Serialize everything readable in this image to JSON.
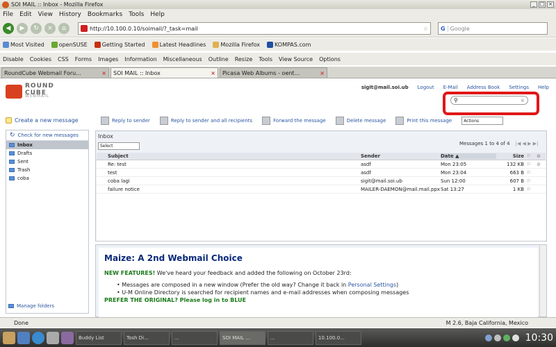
{
  "window": {
    "title": "SOI MAIL :: Inbox - Mozilla Firefox"
  },
  "menu": [
    "File",
    "Edit",
    "View",
    "History",
    "Bookmarks",
    "Tools",
    "Help"
  ],
  "nav": {
    "url": "http://10.100.0.10/soimail/?_task=mail",
    "search_placeholder": "Google"
  },
  "bookmarks": [
    "Most Visited",
    "openSUSE",
    "Getting Started",
    "Latest Headlines",
    "Mozilla Firefox",
    "KOMPAS.com"
  ],
  "devtools": [
    "Disable",
    "Cookies",
    "CSS",
    "Forms",
    "Images",
    "Information",
    "Miscellaneous",
    "Outline",
    "Resize",
    "Tools",
    "View Source",
    "Options"
  ],
  "tabs": [
    "RoundCube Webmail Foru...",
    "SOI MAIL :: Inbox",
    "Picasa Web Albums - oent..."
  ],
  "header": {
    "logo_top": "ROUND CUBE",
    "logo_bottom": "WEBMAIL",
    "user": "sigit@mail.soi.ub",
    "links": [
      "Logout",
      "E-Mail",
      "Address Book",
      "Settings",
      "Help"
    ]
  },
  "sidebar": {
    "create": "Create a new message",
    "check": "Check for new messages",
    "folders": [
      "Inbox",
      "Drafts",
      "Sent",
      "Trash",
      "coba"
    ],
    "manage": "Manage folders"
  },
  "toolbar": {
    "reply": "Reply to sender",
    "reply_all": "Reply to sender and all recipients",
    "forward": "Forward the message",
    "delete": "Delete message",
    "print": "Print this message",
    "actions": "Actions"
  },
  "inbox": {
    "label": "Inbox",
    "select": "Select",
    "count": "Messages 1 to 4 of 4",
    "columns": {
      "subject": "Subject",
      "sender": "Sender",
      "date": "Date",
      "size": "Size"
    },
    "messages": [
      {
        "subject": "Re: test",
        "sender": "asdf",
        "date": "Mon 23:05",
        "size": "132 KB"
      },
      {
        "subject": "test",
        "sender": "asdf",
        "date": "Mon 23:04",
        "size": "663 B"
      },
      {
        "subject": "coba lagi",
        "sender": "sigit@mail.soi.ub",
        "date": "Sun 12:00",
        "size": "607 B"
      },
      {
        "subject": "failure notice",
        "sender": "MAILER-DAEMON@mail.mail.ppx",
        "date": "Sat 13:27",
        "size": "1 KB"
      }
    ]
  },
  "preview": {
    "title": "Maize: A 2nd Webmail Choice",
    "lead_strong": "NEW FEATURES!",
    "lead": " We've heard your feedback and added the following on October 23rd:",
    "bullet1": "Messages are composed in a new window (Prefer the old way? Change it back in ",
    "bullet1_link": "Personal Settings",
    "bullet1_end": ")",
    "bullet2": "U-M Online Directory is searched for recipient names and e-mail addresses when composing messages",
    "cut": "PREFER THE ORIGINAL? Please log in to BLUE"
  },
  "status": {
    "text": "Done",
    "location": "M 2.6, Baja California, Mexico"
  },
  "taskbar": {
    "tasks": [
      "Buddy List",
      "Tosh Di...",
      "...",
      "SOI MAIL ...",
      "...",
      "10.100.0..."
    ],
    "clock": "10:30"
  }
}
